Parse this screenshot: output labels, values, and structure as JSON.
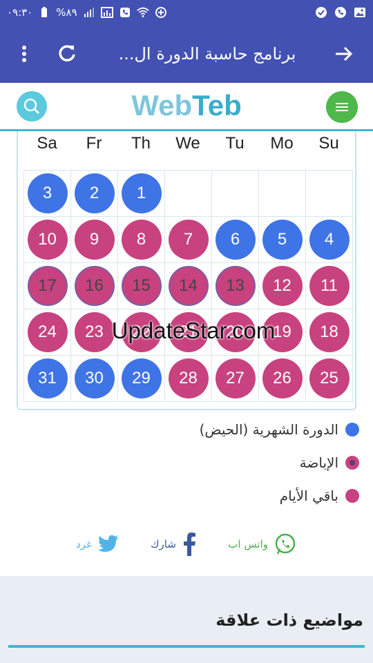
{
  "status": {
    "time": "٠٩:٣٠",
    "battery": "%٨٩"
  },
  "appbar": {
    "title": "برنامج حاسبة الدورة ال..."
  },
  "logo": {
    "part1": "Web",
    "part2": "Teb"
  },
  "calendar": {
    "days": [
      "Sa",
      "Fr",
      "Th",
      "We",
      "Tu",
      "Mo",
      "Su"
    ],
    "rows": [
      [
        {
          "n": "3",
          "t": "period"
        },
        {
          "n": "2",
          "t": "period"
        },
        {
          "n": "1",
          "t": "period"
        },
        {
          "n": "",
          "t": "empty"
        },
        {
          "n": "",
          "t": "empty"
        },
        {
          "n": "",
          "t": "empty"
        },
        {
          "n": "",
          "t": "empty"
        }
      ],
      [
        {
          "n": "10",
          "t": "rest"
        },
        {
          "n": "9",
          "t": "rest"
        },
        {
          "n": "8",
          "t": "rest"
        },
        {
          "n": "7",
          "t": "rest"
        },
        {
          "n": "6",
          "t": "period"
        },
        {
          "n": "5",
          "t": "period"
        },
        {
          "n": "4",
          "t": "period"
        }
      ],
      [
        {
          "n": "17",
          "t": "ovul"
        },
        {
          "n": "16",
          "t": "ovul"
        },
        {
          "n": "15",
          "t": "ovul"
        },
        {
          "n": "14",
          "t": "ovul"
        },
        {
          "n": "13",
          "t": "ovul"
        },
        {
          "n": "12",
          "t": "rest"
        },
        {
          "n": "11",
          "t": "rest"
        }
      ],
      [
        {
          "n": "24",
          "t": "rest"
        },
        {
          "n": "23",
          "t": "rest"
        },
        {
          "n": "22",
          "t": "rest"
        },
        {
          "n": "21",
          "t": "rest"
        },
        {
          "n": "20",
          "t": "rest"
        },
        {
          "n": "19",
          "t": "rest"
        },
        {
          "n": "18",
          "t": "rest"
        }
      ],
      [
        {
          "n": "31",
          "t": "period"
        },
        {
          "n": "30",
          "t": "period"
        },
        {
          "n": "29",
          "t": "period"
        },
        {
          "n": "28",
          "t": "rest"
        },
        {
          "n": "27",
          "t": "rest"
        },
        {
          "n": "26",
          "t": "rest"
        },
        {
          "n": "25",
          "t": "rest"
        }
      ]
    ],
    "colors": {
      "period": "#3f74e6",
      "rest": "#c8427f",
      "ovulation_ring": "#7a5fa5"
    }
  },
  "legend": {
    "period": "الدورة الشهرية (الحيض)",
    "ovulation": "الإباضة",
    "rest": "باقي الأيام"
  },
  "share": {
    "whatsapp": "واتس اب",
    "facebook": "شارك",
    "twitter": "غرد"
  },
  "related": {
    "heading": "مواضيع ذات علاقة"
  },
  "watermark": "UpdateStar.com"
}
